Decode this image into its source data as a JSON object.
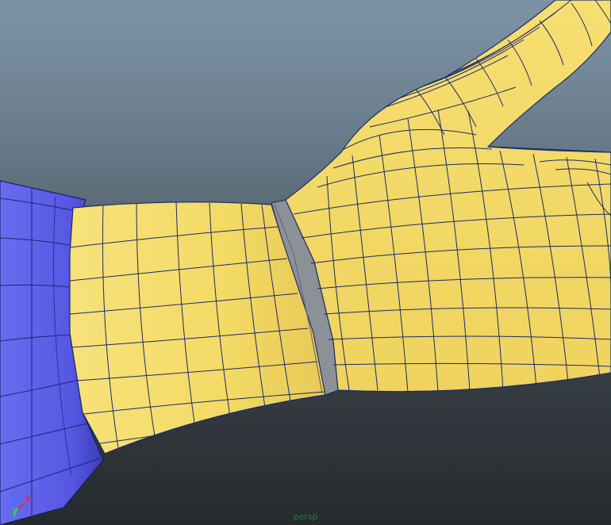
{
  "viewport": {
    "camera_name": "persp"
  },
  "axes": {
    "x_label": "x",
    "y_label": "y",
    "z_label": "z",
    "x_color": "#e0302a",
    "y_color": "#38d84a",
    "z_color": "#3a6dff"
  },
  "colors": {
    "sleeve": "#5a5ce8",
    "sleeve_dark": "#3f41c4",
    "glove": "#f5dc6b",
    "glove_shade": "#e7c852",
    "wire": "#1a2a6a",
    "band": "#8a8f96"
  }
}
